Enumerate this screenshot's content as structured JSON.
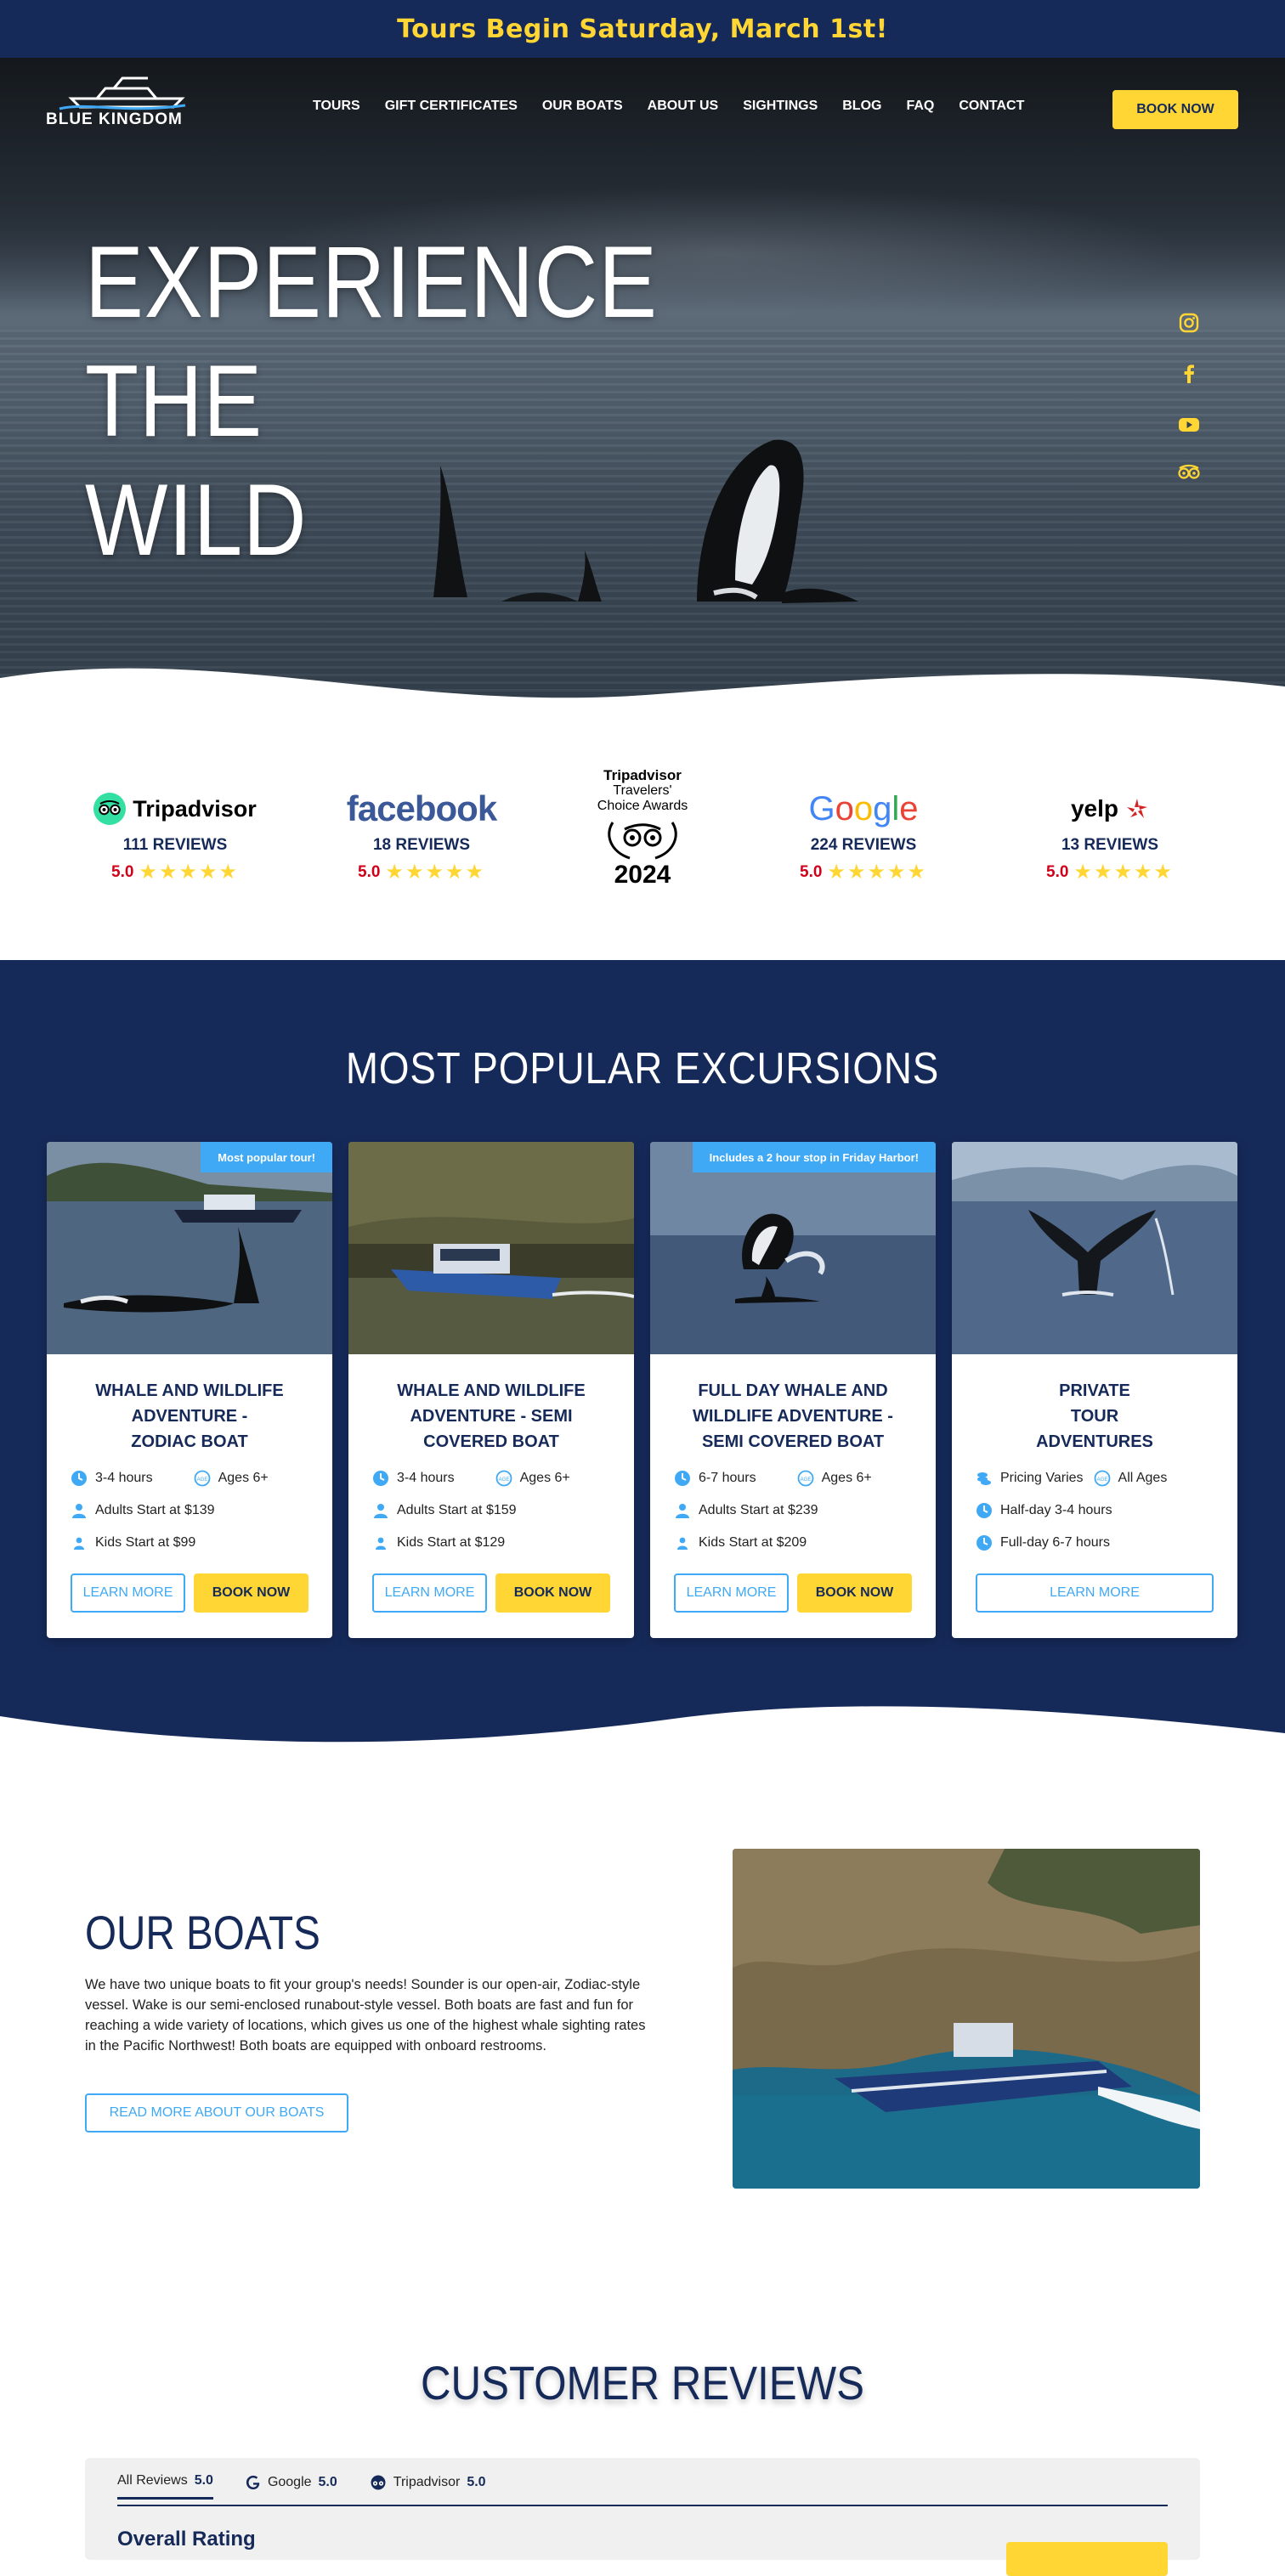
{
  "announcement": "Tours Begin Saturday, March 1st!",
  "brand": {
    "name": "BLUE KINGDOM"
  },
  "nav": {
    "items": [
      "TOURS",
      "GIFT CERTIFICATES",
      "OUR BOATS",
      "ABOUT US",
      "SIGHTINGS",
      "BLOG",
      "FAQ",
      "CONTACT"
    ],
    "book_label": "BOOK NOW"
  },
  "hero": {
    "lines": [
      "EXPERIENCE",
      "THE",
      "WILD"
    ],
    "social": [
      "instagram-icon",
      "facebook-icon",
      "youtube-icon",
      "tripadvisor-icon"
    ]
  },
  "ratings": [
    {
      "brand": "Tripadvisor",
      "count": "111 REVIEWS",
      "score": "5.0",
      "stars": 5
    },
    {
      "brand": "facebook",
      "count": "18 REVIEWS",
      "score": "5.0",
      "stars": 5
    },
    {
      "brand": "Google",
      "count": "224 REVIEWS",
      "score": "5.0",
      "stars": 5
    },
    {
      "brand": "yelp",
      "count": "13 REVIEWS",
      "score": "5.0",
      "stars": 5
    }
  ],
  "award": {
    "line1": "Tripadvisor",
    "line2": "Travelers'",
    "line3": "Choice Awards",
    "year": "2024"
  },
  "excursions": {
    "title": "MOST POPULAR EXCURSIONS",
    "cards": [
      {
        "ribbon": "Most popular tour!",
        "title": [
          "WHALE AND WILDLIFE",
          "ADVENTURE -",
          "ZODIAC BOAT"
        ],
        "duration": "3-4 hours",
        "ages": "Ages 6+",
        "adults": "Adults Start at $139",
        "kids": "Kids Start at $99",
        "learn": "LEARN MORE",
        "book": "BOOK NOW"
      },
      {
        "ribbon": "",
        "title": [
          "WHALE AND WILDLIFE",
          "ADVENTURE - SEMI",
          "COVERED BOAT"
        ],
        "duration": "3-4 hours",
        "ages": "Ages 6+",
        "adults": "Adults Start at $159",
        "kids": "Kids Start at $129",
        "learn": "LEARN MORE",
        "book": "BOOK NOW"
      },
      {
        "ribbon": "Includes a 2 hour stop in Friday Harbor!",
        "title": [
          "FULL DAY WHALE AND",
          "WILDLIFE ADVENTURE -",
          "SEMI COVERED BOAT"
        ],
        "duration": "6-7 hours",
        "ages": "Ages 6+",
        "adults": "Adults Start at $239",
        "kids": "Kids Start at $209",
        "learn": "LEARN MORE",
        "book": "BOOK NOW"
      },
      {
        "ribbon": "",
        "title": [
          "PRIVATE",
          "TOUR",
          "ADVENTURES"
        ],
        "pricing": "Pricing Varies",
        "ages": "All Ages",
        "half": "Half-day 3-4 hours",
        "full": "Full-day 6-7 hours",
        "learn": "LEARN MORE"
      }
    ]
  },
  "boats": {
    "title": "OUR BOATS",
    "body": "We have two unique boats to fit your group's needs! Sounder is our open-air, Zodiac-style vessel. Wake is our semi-enclosed runabout-style vessel. Both boats are fast and fun for reaching a wide variety of locations, which gives us one of the highest whale sighting rates in the Pacific Northwest! Both boats are equipped with onboard restrooms.",
    "button": "READ MORE ABOUT OUR BOATS"
  },
  "reviews": {
    "title": "CUSTOMER REVIEWS",
    "tabs": [
      {
        "label": "All Reviews",
        "score": "5.0"
      },
      {
        "label": "Google",
        "score": "5.0"
      },
      {
        "label": "Tripadvisor",
        "score": "5.0"
      }
    ],
    "overall": "Overall Rating"
  },
  "colors": {
    "navy": "#162a5a",
    "yellow": "#ffd633",
    "sky": "#3fa9f5",
    "red": "#d0021b"
  }
}
